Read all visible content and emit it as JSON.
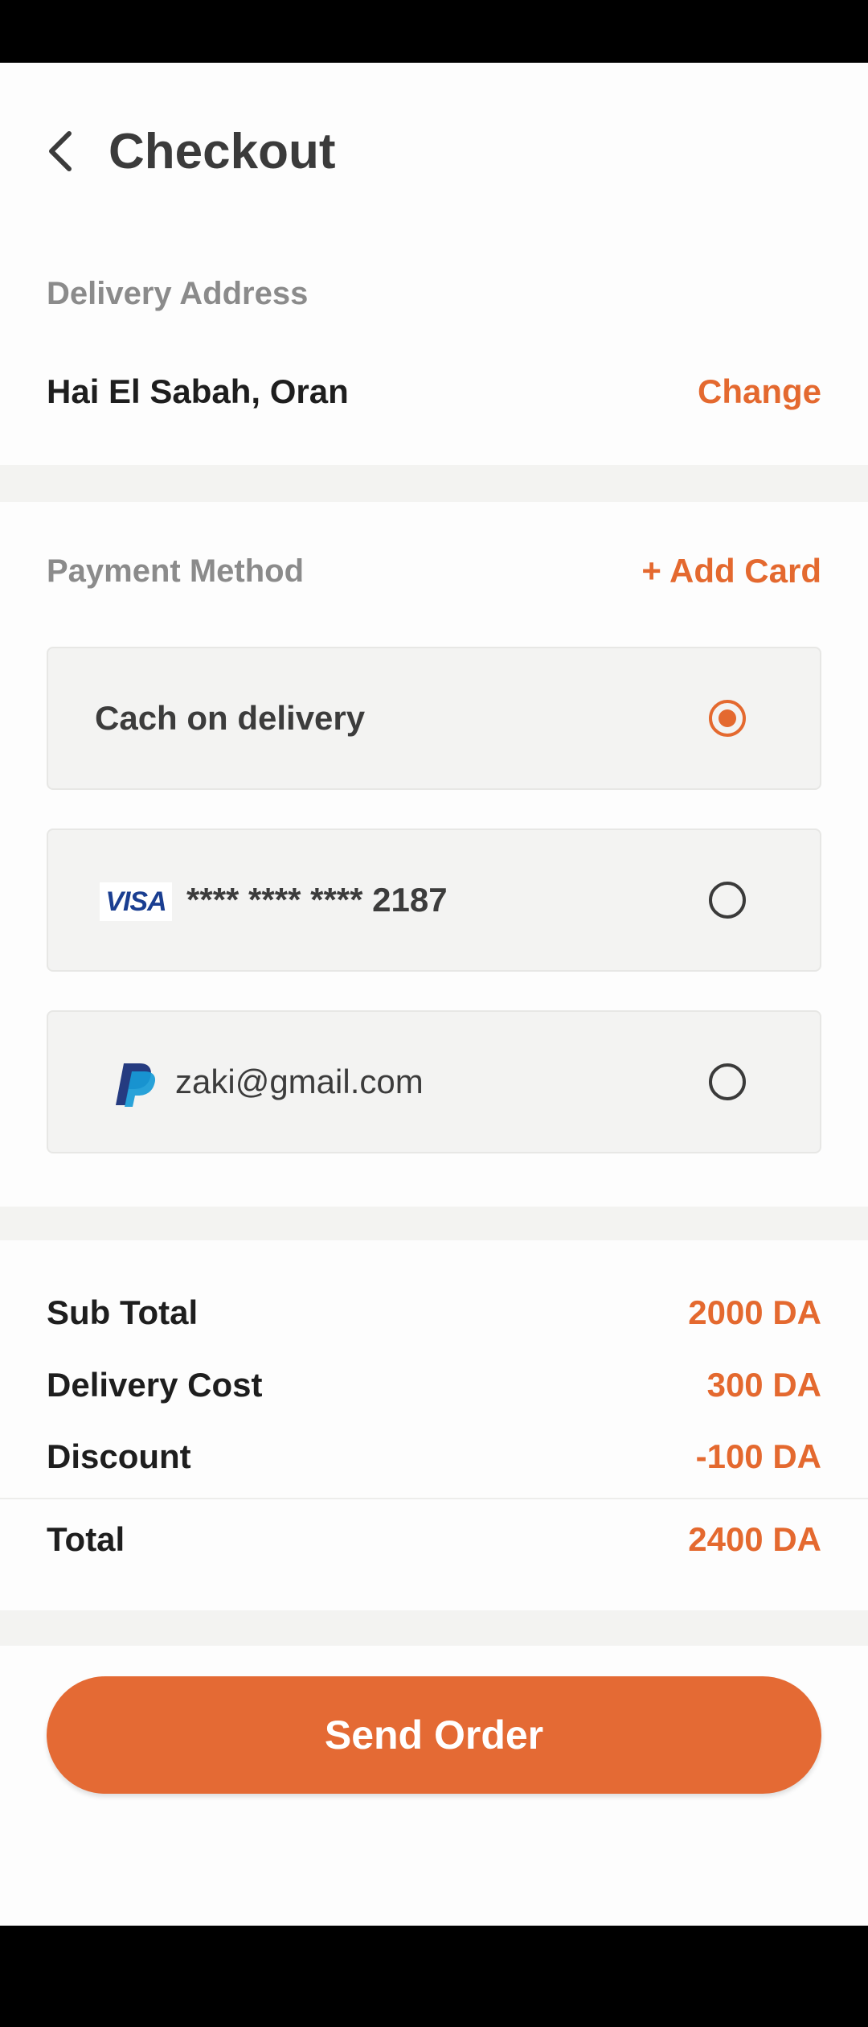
{
  "header": {
    "title": "Checkout"
  },
  "delivery": {
    "label": "Delivery Address",
    "address": "Hai El Sabah, Oran",
    "change_label": "Change"
  },
  "payment": {
    "label": "Payment Method",
    "add_card_label": "+ Add Card",
    "options": [
      {
        "text": "Cach on delivery",
        "selected": true
      },
      {
        "logo": "VISA",
        "text": "**** **** **** 2187",
        "selected": false
      },
      {
        "text": "zaki@gmail.com",
        "selected": false
      }
    ]
  },
  "totals": {
    "rows": [
      {
        "label": "Sub Total",
        "value": "2000 DA"
      },
      {
        "label": "Delivery Cost",
        "value": "300 DA"
      },
      {
        "label": "Discount",
        "value": "-100 DA"
      },
      {
        "label": "Total",
        "value": "2400 DA"
      }
    ]
  },
  "actions": {
    "send_order_label": "Send Order"
  },
  "colors": {
    "accent": "#e4692f",
    "background": "#f3f3f1",
    "card": "#fdfdfd"
  },
  "icons": [
    "back-arrow-icon",
    "visa-logo-icon",
    "paypal-logo-icon"
  ]
}
